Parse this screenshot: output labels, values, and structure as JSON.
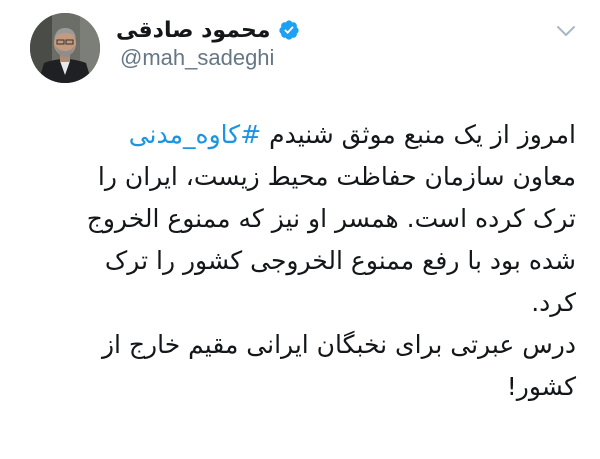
{
  "user": {
    "display_name": "محمود صادقی",
    "handle": "@mah_sadeghi",
    "verified_icon": "verified-badge",
    "avatar_icon": "profile-photo"
  },
  "menu": {
    "icon": "chevron-down-icon"
  },
  "tweet": {
    "line1_prefix": "امروز از یک منبع موثق شنیدم ",
    "line1_hashtag": "#کاوه_مدنی",
    "line2": "معاون سازمان حفاظت محیط زیست، ایران را",
    "line3": "ترک کرده است. همسر او نیز که ممنوع الخروج",
    "line4": "شده بود با رفع ممنوع الخروجی کشور را ترک",
    "line5": "کرد.",
    "line6": "درس عبرتی برای نخبگان ایرانی مقیم خارج از",
    "line7": "کشور!"
  },
  "colors": {
    "hashtag": "#1b95e0",
    "verified": "#1da1f2",
    "secondary_text": "#657786"
  }
}
